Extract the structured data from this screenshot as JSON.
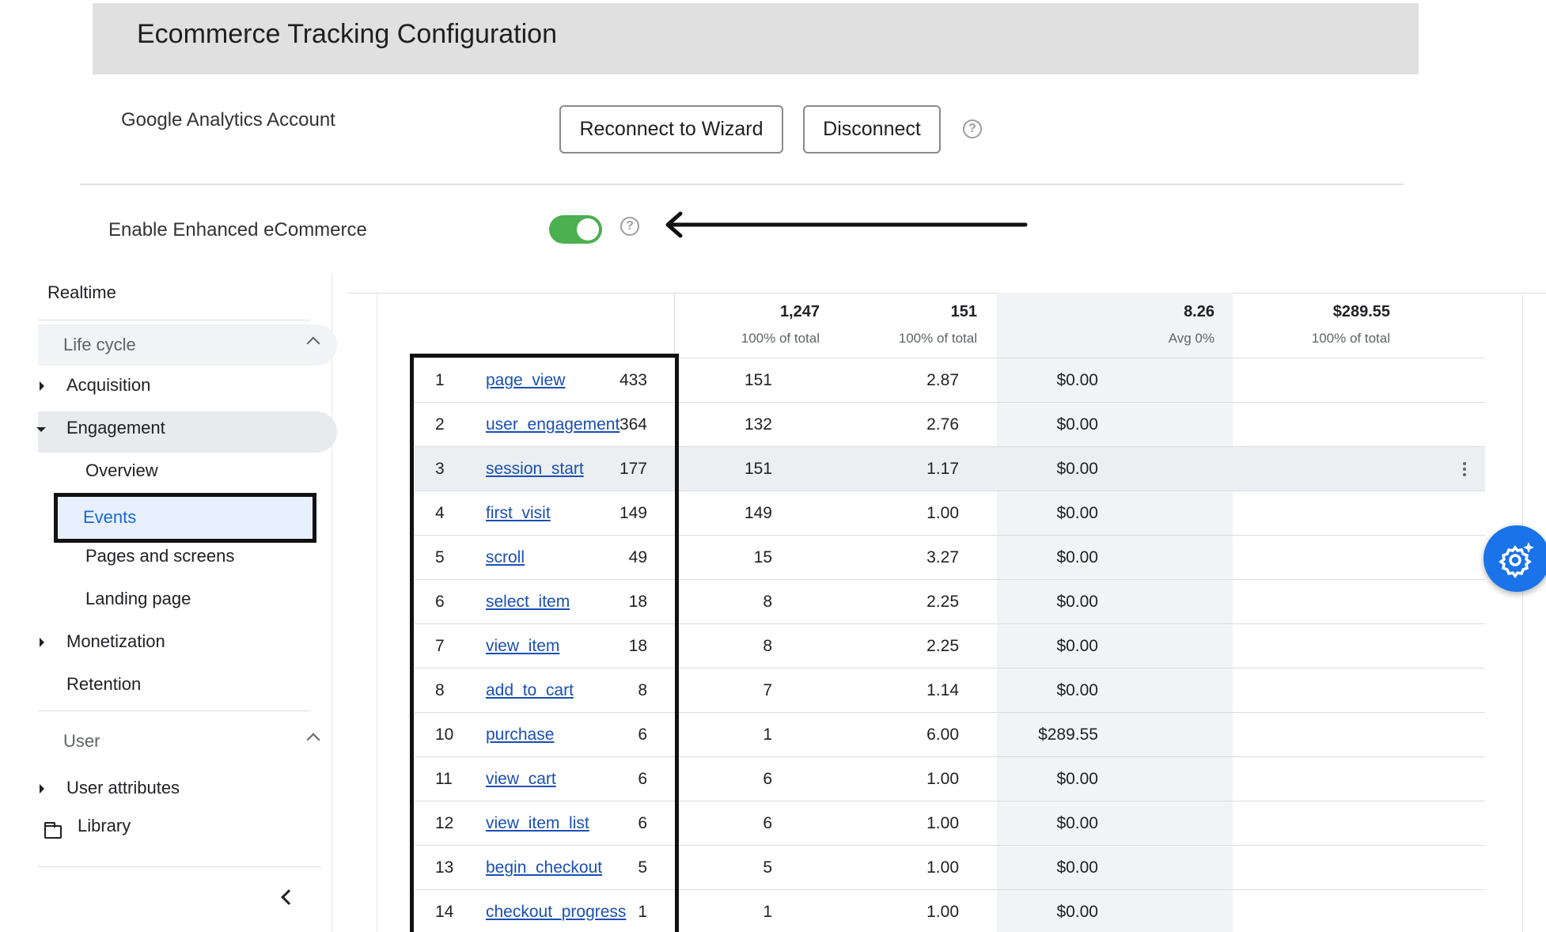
{
  "config": {
    "title": "Ecommerce Tracking Configuration",
    "ga_account_label": "Google Analytics Account",
    "reconnect_label": "Reconnect to Wizard",
    "disconnect_label": "Disconnect",
    "enhanced_label": "Enable Enhanced eCommerce",
    "enhanced_enabled": true,
    "toggle_color": "#4caf50"
  },
  "sidebar": {
    "realtime": "Realtime",
    "lifecycle": "Life cycle",
    "acquisition": "Acquisition",
    "engagement": "Engagement",
    "overview": "Overview",
    "events": "Events",
    "pages_screens": "Pages and screens",
    "landing_page": "Landing page",
    "monetization": "Monetization",
    "retention": "Retention",
    "user": "User",
    "user_attributes": "User attributes",
    "library": "Library"
  },
  "table": {
    "totals": [
      {
        "value": "1,247",
        "sub": "100% of total"
      },
      {
        "value": "151",
        "sub": "100% of total"
      },
      {
        "value": "8.26",
        "sub": "Avg 0%"
      },
      {
        "value": "$289.55",
        "sub": "100% of total"
      }
    ],
    "rows": [
      {
        "idx": "1",
        "name": "page_view",
        "c1": "433",
        "c2": "151",
        "c3": "2.87",
        "c4": "$0.00"
      },
      {
        "idx": "2",
        "name": "user_engagement",
        "c1": "364",
        "c2": "132",
        "c3": "2.76",
        "c4": "$0.00"
      },
      {
        "idx": "3",
        "name": "session_start",
        "c1": "177",
        "c2": "151",
        "c3": "1.17",
        "c4": "$0.00"
      },
      {
        "idx": "4",
        "name": "first_visit",
        "c1": "149",
        "c2": "149",
        "c3": "1.00",
        "c4": "$0.00"
      },
      {
        "idx": "5",
        "name": "scroll",
        "c1": "49",
        "c2": "15",
        "c3": "3.27",
        "c4": "$0.00"
      },
      {
        "idx": "6",
        "name": "select_item",
        "c1": "18",
        "c2": "8",
        "c3": "2.25",
        "c4": "$0.00"
      },
      {
        "idx": "7",
        "name": "view_item",
        "c1": "18",
        "c2": "8",
        "c3": "2.25",
        "c4": "$0.00"
      },
      {
        "idx": "8",
        "name": "add_to_cart",
        "c1": "8",
        "c2": "7",
        "c3": "1.14",
        "c4": "$0.00"
      },
      {
        "idx": "10",
        "name": "purchase",
        "c1": "6",
        "c2": "1",
        "c3": "6.00",
        "c4": "$289.55"
      },
      {
        "idx": "11",
        "name": "view_cart",
        "c1": "6",
        "c2": "6",
        "c3": "1.00",
        "c4": "$0.00"
      },
      {
        "idx": "12",
        "name": "view_item_list",
        "c1": "6",
        "c2": "6",
        "c3": "1.00",
        "c4": "$0.00"
      },
      {
        "idx": "13",
        "name": "begin_checkout",
        "c1": "5",
        "c2": "5",
        "c3": "1.00",
        "c4": "$0.00"
      },
      {
        "idx": "14",
        "name": "checkout_progress",
        "c1": "1",
        "c2": "1",
        "c3": "1.00",
        "c4": "$0.00"
      }
    ],
    "highlighted_row": 2
  },
  "colors": {
    "link": "#1a4fb3",
    "fab": "#1a73e8",
    "active_nav_bg": "#e8f0fe"
  }
}
